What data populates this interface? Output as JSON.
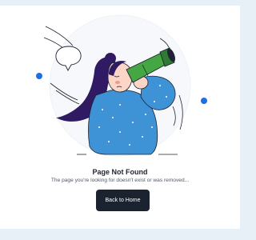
{
  "page": {
    "title": "Page Not Found",
    "message": "The page you're looking for doesn't exist or was removed...",
    "home_button_label": "Back to Home"
  },
  "colors": {
    "background": "#e6f0f6",
    "card": "#ffffff",
    "button": "#1c2330",
    "accent_blue": "#1f6ee8",
    "shirt_blue": "#3e92d6",
    "hair": "#2f1a63",
    "telescope_green": "#45a644"
  },
  "icons": {
    "speech_bubble": "speech-bubble-icon"
  }
}
